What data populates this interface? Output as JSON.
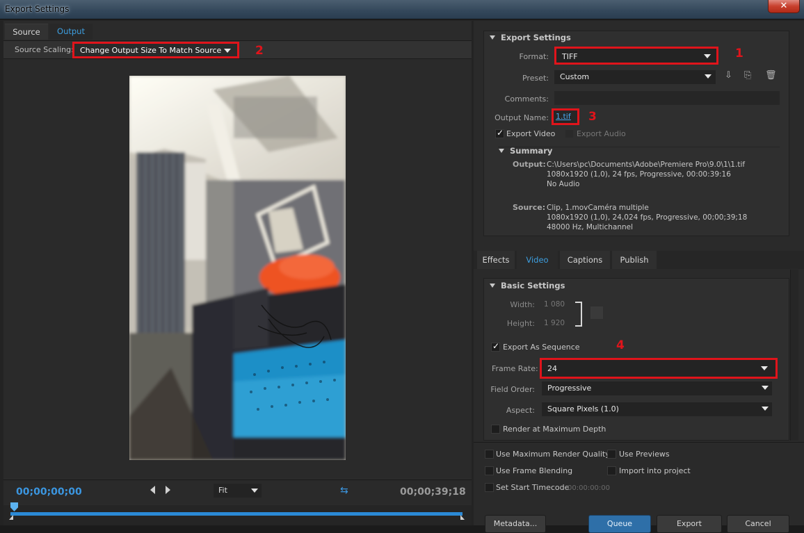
{
  "window": {
    "title": "Export Settings",
    "close_glyph": "✕"
  },
  "left": {
    "tabs": [
      "Source",
      "Output"
    ],
    "active_tab": "Output",
    "source_scaling_label": "Source Scaling:",
    "source_scaling_value": "Change Output Size To Match Source",
    "timecode_start": "00;00;00;00",
    "timecode_end": "00;00;39;18",
    "zoom": "Fit"
  },
  "annotations": [
    "1",
    "2",
    "3",
    "4"
  ],
  "export_settings": {
    "title": "Export Settings",
    "format_label": "Format:",
    "format_value": "TIFF",
    "preset_label": "Preset:",
    "preset_value": "Custom",
    "comments_label": "Comments:",
    "output_name_label": "Output Name:",
    "output_name_value": "1.tif",
    "export_video_label": "Export Video",
    "export_audio_label": "Export Audio",
    "export_video_checked": true,
    "export_audio_checked": false,
    "icons": [
      "save-preset-icon",
      "import-preset-icon",
      "delete-preset-icon"
    ]
  },
  "summary": {
    "title": "Summary",
    "output_label": "Output:",
    "output_lines": [
      "C:\\Users\\pc\\Documents\\Adobe\\Premiere Pro\\9.0\\1\\1.tif",
      "1080x1920 (1,0), 24 fps, Progressive, 00:00:39:16",
      "No Audio"
    ],
    "source_label": "Source:",
    "source_lines": [
      "Clip, 1.movCaméra multiple",
      "1080x1920 (1,0), 24,024 fps, Progressive, 00;00;39;18",
      "48000 Hz, Multichannel"
    ]
  },
  "settings_tabs": [
    "Effects",
    "Video",
    "Captions",
    "Publish"
  ],
  "settings_active_tab": "Video",
  "basic_settings": {
    "title": "Basic Settings",
    "width_label": "Width:",
    "width_value": "1 080",
    "height_label": "Height:",
    "height_value": "1 920",
    "export_as_sequence_label": "Export As Sequence",
    "export_as_sequence_checked": true,
    "frame_rate_label": "Frame Rate:",
    "frame_rate_value": "24",
    "field_order_label": "Field Order:",
    "field_order_value": "Progressive",
    "aspect_label": "Aspect:",
    "aspect_value": "Square Pixels (1.0)",
    "render_max_depth_label": "Render at Maximum Depth",
    "render_max_depth_checked": false
  },
  "options": {
    "use_max_render_quality": "Use Maximum Render Quality",
    "use_previews": "Use Previews",
    "use_frame_blending": "Use Frame Blending",
    "import_into_project": "Import into project",
    "set_start_timecode": "Set Start Timecode",
    "start_timecode_value": "00:00:00:00"
  },
  "buttons": {
    "metadata": "Metadata...",
    "queue": "Queue",
    "export": "Export",
    "cancel": "Cancel"
  },
  "colors": {
    "annotation_red": "#e0141b",
    "accent_blue": "#3b96e0"
  }
}
